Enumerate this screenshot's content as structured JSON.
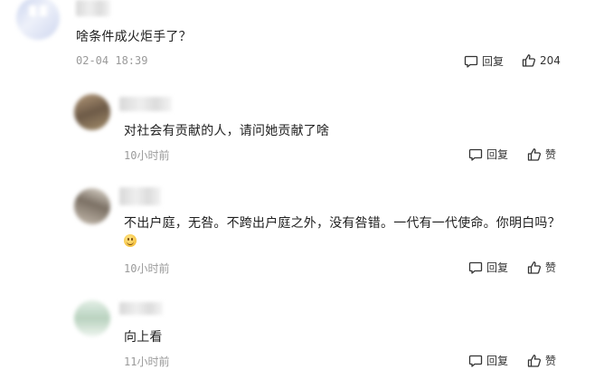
{
  "main_comment": {
    "text": "啥条件成火炬手了？",
    "time": "02-04 18:39",
    "reply_label": "回复",
    "like_count": "204",
    "avatar_icon": "user-avatar-blurred"
  },
  "replies": [
    {
      "text": "对社会有贡献的人，请问她贡献了啥",
      "time": "10小时前",
      "reply_label": "回复",
      "like_label": "赞"
    },
    {
      "text": "不出户庭，无咎。不跨出户庭之外，没有咎错。一代有一代使命。你明白吗？",
      "time": "10小时前",
      "reply_label": "回复",
      "like_label": "赞",
      "emoji": "grinning-face"
    },
    {
      "text": "向上看",
      "time": "11小时前",
      "reply_label": "回复",
      "like_label": "赞"
    }
  ],
  "icons": {
    "reply": "comment-bubble-icon",
    "like": "thumb-up-icon"
  },
  "colors": {
    "text": "#1f1f1f",
    "meta": "#9a9a9a",
    "background": "#ffffff"
  }
}
